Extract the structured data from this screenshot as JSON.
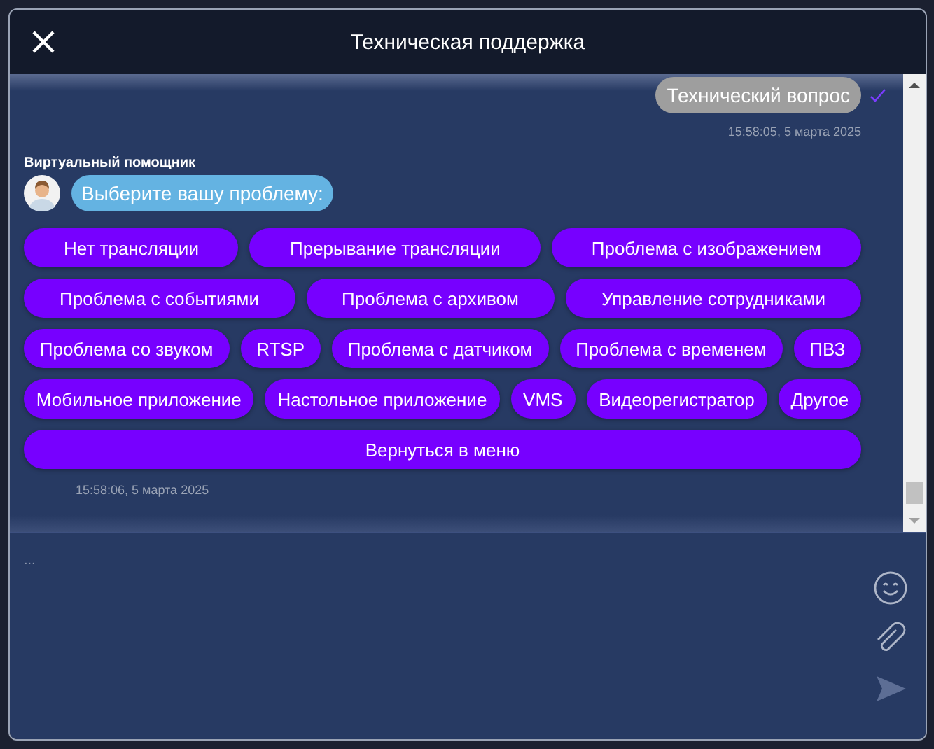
{
  "window": {
    "title": "Техническая поддержка"
  },
  "messages": [
    {
      "kind": "outgoing",
      "text": "Технический вопрос",
      "time": "15:58:05, 5 марта 2025"
    },
    {
      "kind": "bot",
      "sender": "Виртуальный помощник",
      "text": "Выберите вашу проблему:",
      "time": "15:58:06, 5 марта 2025",
      "option_rows": [
        [
          "Нет трансляции",
          "Прерывание трансляции",
          "Проблема с изображением"
        ],
        [
          "Проблема с событиями",
          "Проблема с архивом",
          "Управление сотрудниками"
        ],
        [
          "Проблема со звуком",
          "RTSP",
          "Проблема с датчиком",
          "Проблема с временем",
          "ПВЗ"
        ],
        [
          "Мобильное приложение",
          "Настольное приложение",
          "VMS",
          "Видеорегистратор",
          "Другое"
        ],
        [
          "Вернуться в меню"
        ]
      ]
    }
  ],
  "composer": {
    "placeholder": "..."
  }
}
